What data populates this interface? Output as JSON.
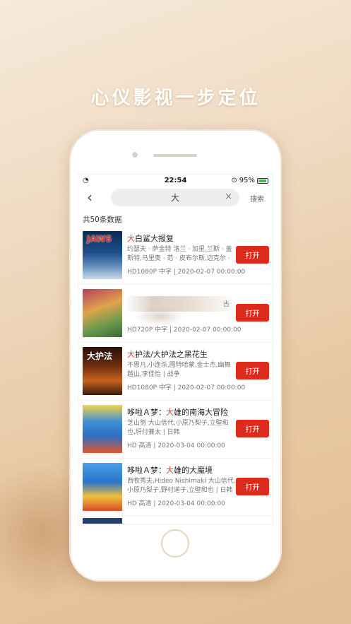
{
  "headline": "心仪影视一步定位",
  "status_bar": {
    "time": "22:54",
    "battery": "95%"
  },
  "search": {
    "query": "大",
    "button_label": "搜索"
  },
  "result_count": "共50条数据",
  "items": [
    {
      "title_pre": "",
      "title_hl": "大",
      "title_post": "白鲨大报复",
      "poster_text": "JAWS",
      "cast": "约瑟夫 · 萨金特 洛兰 · 加里,兰斯 · 盖斯特,马里奥 · 范 · 皮布尔斯,迈克尔 · 凯...",
      "meta": "HD1080P 中字 | 2020-02-07 00:00:00",
      "button": "打开"
    },
    {
      "title_pre": "",
      "title_hl": "",
      "title_post": "",
      "poster_text": "",
      "cast": "古",
      "meta": "HD720P 中字 | 2020-02-07 00:00:00",
      "button": "打开"
    },
    {
      "title_pre": "",
      "title_hl": "大",
      "title_post": "护法/大护法之黑花生",
      "poster_text": "大护法",
      "cast": "不恩凡,小连杀,图特哈蒙,金士杰,幽舞越山,李佳怡 | 战争",
      "meta": "HD1080P 中字 | 2020-02-07 00:00:00",
      "button": "打开"
    },
    {
      "title_pre": "哆啦Ａ梦：",
      "title_hl": "大",
      "title_post": "雄的南海大冒险",
      "poster_text": "",
      "cast": "芝山努 大山信代,小原乃梨子,立壁和也,肝付兼太 | 日韩",
      "meta": "HD 高清 | 2020-03-04 00:00:00",
      "button": "打开"
    },
    {
      "title_pre": "哆啦Ａ梦：",
      "title_hl": "大",
      "title_post": "雄的大魔境",
      "poster_text": "",
      "cast": "西牧秀夫,Hideo Nishimaki 大山信代,小原乃梨子,野村道子,立壁和也 | 日韩",
      "meta": "HD 高清 | 2020-03-04 00:00:00",
      "button": "打开"
    }
  ]
}
